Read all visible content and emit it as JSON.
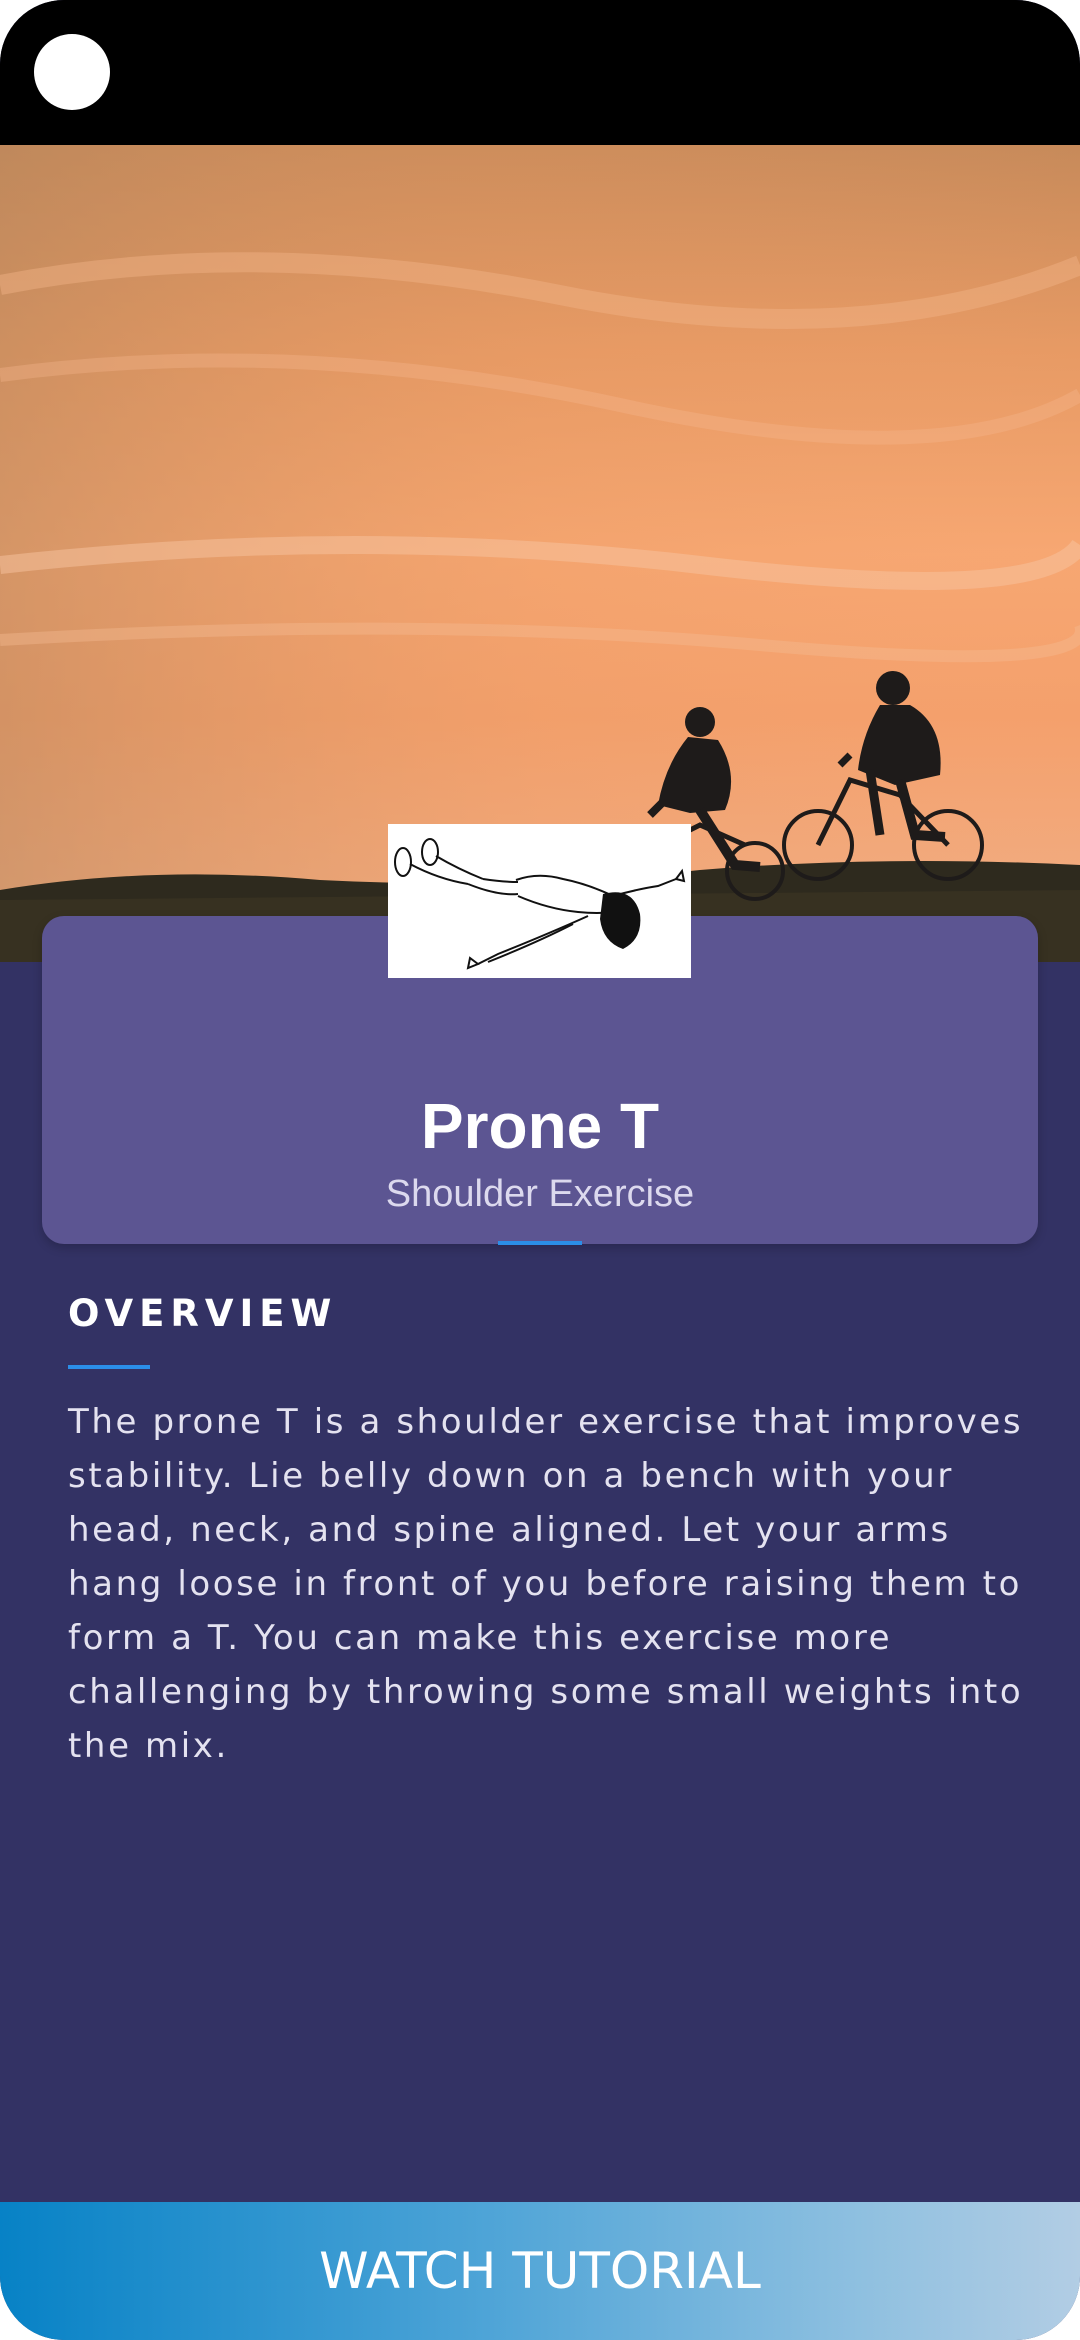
{
  "exercise": {
    "title": "Prone T",
    "subtitle": "Shoulder Exercise"
  },
  "overview": {
    "heading": "OVERVIEW",
    "text": "The prone T is a shoulder exercise that improves stability. Lie belly down on a bench with your head, neck, and spine aligned. Let your arms hang loose in front of you before raising them to form a T. You can make this exercise more challenging by throwing some small weights into the mix."
  },
  "actions": {
    "watch_label": "WATCH TUTORIAL"
  },
  "colors": {
    "background": "#333264",
    "card": "#5c5592",
    "accent": "#2b8ee8",
    "button_start": "#0782c6",
    "button_end": "#b2cde4"
  }
}
